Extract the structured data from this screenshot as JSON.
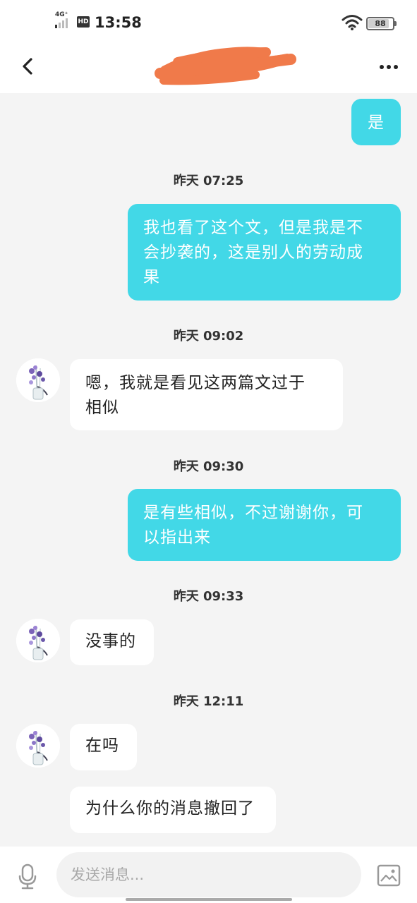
{
  "status_bar": {
    "network": "4G⁺",
    "hd": "HD",
    "time": "13:58",
    "battery": "88"
  },
  "header": {
    "title_redacted": true,
    "colors": {
      "redaction": "#f07a4a"
    }
  },
  "messages": [
    {
      "type": "outgoing",
      "text": "是"
    },
    {
      "type": "timestamp",
      "text": "昨天 07:25"
    },
    {
      "type": "outgoing",
      "lines": [
        "我也看了这个文，但是我是不",
        "会抄袭的，这是别人的劳动成",
        "果"
      ]
    },
    {
      "type": "timestamp",
      "text": "昨天 09:02"
    },
    {
      "type": "incoming",
      "lines": [
        "嗯，我就是看见这两篇文过于",
        "相似"
      ]
    },
    {
      "type": "timestamp",
      "text": "昨天 09:30"
    },
    {
      "type": "outgoing",
      "lines": [
        "是有些相似，不过谢谢你，可",
        "以指出来"
      ]
    },
    {
      "type": "timestamp",
      "text": "昨天 09:33"
    },
    {
      "type": "incoming",
      "text": "没事的"
    },
    {
      "type": "timestamp",
      "text": "昨天 12:11"
    },
    {
      "type": "incoming",
      "text": "在吗"
    },
    {
      "type": "incoming",
      "text": "为什么你的消息撤回了"
    }
  ],
  "input": {
    "placeholder": "发送消息..."
  },
  "colors": {
    "outgoing_bubble": "#42d8e7",
    "incoming_bubble": "#ffffff",
    "background": "#f4f4f4"
  },
  "icons": [
    "back-arrow-icon",
    "more-dots-icon",
    "microphone-icon",
    "image-icon",
    "wifi-icon",
    "battery-icon"
  ]
}
